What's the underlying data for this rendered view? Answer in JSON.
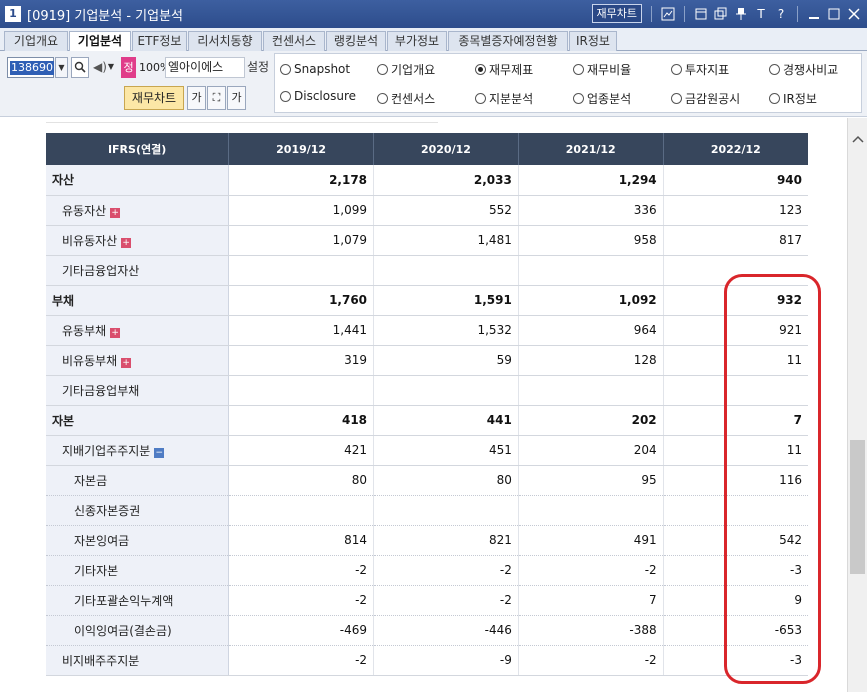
{
  "window": {
    "number": "1",
    "title": "[0919] 기업분석 - 기업분석",
    "fin_chart_button": "재무차트",
    "icons": [
      "chart-icon",
      "restore-icon",
      "copy-icon",
      "pin-icon",
      "font-icon",
      "help-icon",
      "minimize-icon",
      "maximize-icon",
      "close-icon"
    ]
  },
  "tabs": [
    {
      "label": "기업개요",
      "active": false
    },
    {
      "label": "기업분석",
      "active": true
    },
    {
      "label": "ETF정보",
      "active": false
    },
    {
      "label": "리서치동향",
      "active": false
    },
    {
      "label": "컨센서스",
      "active": false
    },
    {
      "label": "랭킹분석",
      "active": false
    },
    {
      "label": "부가정보",
      "active": false
    },
    {
      "label": "종목별증자예정현황",
      "active": false
    },
    {
      "label": "IR정보",
      "active": false
    }
  ],
  "toolbar": {
    "stock_code": "138690",
    "jeong_label": "정",
    "zoom": "100%",
    "company_name": "엘아이에스",
    "setting_label": "설정",
    "fin_chart_label": "재무차트",
    "mini_buttons": [
      "가",
      "⛶",
      "가"
    ]
  },
  "radios": [
    {
      "label": "Snapshot",
      "checked": false
    },
    {
      "label": "기업개요",
      "checked": false
    },
    {
      "label": "재무제표",
      "checked": true
    },
    {
      "label": "재무비율",
      "checked": false
    },
    {
      "label": "투자지표",
      "checked": false
    },
    {
      "label": "경쟁사비교",
      "checked": false
    },
    {
      "label": "Disclosure",
      "checked": false
    },
    {
      "label": "컨센서스",
      "checked": false
    },
    {
      "label": "지분분석",
      "checked": false
    },
    {
      "label": "업종분석",
      "checked": false
    },
    {
      "label": "금감원공시",
      "checked": false
    },
    {
      "label": "IR정보",
      "checked": false
    }
  ],
  "table": {
    "header": [
      "IFRS(연결)",
      "2019/12",
      "2020/12",
      "2021/12",
      "2022/12"
    ],
    "rows": [
      {
        "label": "자산",
        "level": 0,
        "bold": true,
        "values": [
          "2,178",
          "2,033",
          "1,294",
          "940"
        ]
      },
      {
        "label": "유동자산",
        "level": 1,
        "expand": "plus",
        "values": [
          "1,099",
          "552",
          "336",
          "123"
        ]
      },
      {
        "label": "비유동자산",
        "level": 1,
        "expand": "plus",
        "values": [
          "1,079",
          "1,481",
          "958",
          "817"
        ]
      },
      {
        "label": "기타금융업자산",
        "level": 1,
        "values": [
          "",
          "",
          "",
          ""
        ]
      },
      {
        "label": "부채",
        "level": 0,
        "bold": true,
        "values": [
          "1,760",
          "1,591",
          "1,092",
          "932"
        ]
      },
      {
        "label": "유동부채",
        "level": 1,
        "expand": "plus",
        "values": [
          "1,441",
          "1,532",
          "964",
          "921"
        ]
      },
      {
        "label": "비유동부채",
        "level": 1,
        "expand": "plus",
        "values": [
          "319",
          "59",
          "128",
          "11"
        ]
      },
      {
        "label": "기타금융업부채",
        "level": 1,
        "values": [
          "",
          "",
          "",
          ""
        ]
      },
      {
        "label": "자본",
        "level": 0,
        "bold": true,
        "values": [
          "418",
          "441",
          "202",
          "7"
        ]
      },
      {
        "label": "지배기업주주지분",
        "level": 1,
        "expand": "minus",
        "values": [
          "421",
          "451",
          "204",
          "11"
        ]
      },
      {
        "label": "자본금",
        "level": 2,
        "values": [
          "80",
          "80",
          "95",
          "116"
        ]
      },
      {
        "label": "신종자본증권",
        "level": 2,
        "values": [
          "",
          "",
          "",
          ""
        ]
      },
      {
        "label": "자본잉여금",
        "level": 2,
        "values": [
          "814",
          "821",
          "491",
          "542"
        ]
      },
      {
        "label": "기타자본",
        "level": 2,
        "values": [
          "-2",
          "-2",
          "-2",
          "-3"
        ]
      },
      {
        "label": "기타포괄손익누계액",
        "level": 2,
        "values": [
          "-2",
          "-2",
          "7",
          "9"
        ]
      },
      {
        "label": "이익잉여금(결손금)",
        "level": 2,
        "values": [
          "-469",
          "-446",
          "-388",
          "-653"
        ]
      },
      {
        "label": "비지배주주지분",
        "level": 1,
        "values": [
          "-2",
          "-9",
          "-2",
          "-3"
        ]
      }
    ]
  },
  "colors": {
    "header_bg": "#37465c",
    "negative": "#c2252a",
    "highlight": "#d9262b",
    "title_bar": "#2d4d8c"
  }
}
